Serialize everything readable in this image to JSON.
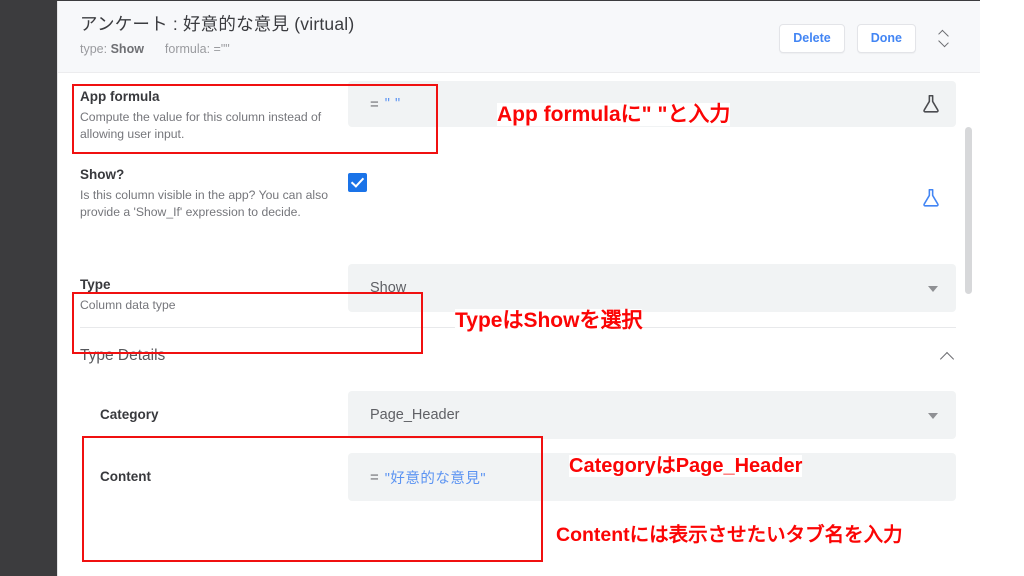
{
  "header": {
    "title": "アンケート : 好意的な意見 (virtual)",
    "meta_type_label": "type:",
    "meta_type_value": "Show",
    "meta_formula_label": "formula:",
    "meta_formula_value": "=\"\"",
    "delete_label": "Delete",
    "done_label": "Done",
    "reorder_icon": "up-down-chevron-icon"
  },
  "rows": {
    "app_formula": {
      "title": "App formula",
      "desc": "Compute the value for this column instead of allowing user input.",
      "equals": "=",
      "value": "\" \"",
      "flask_icon": "flask-icon",
      "flask_color": "#4b4c50"
    },
    "show": {
      "title": "Show?",
      "desc": "Is this column visible in the app? You can also provide a 'Show_If' expression to decide.",
      "checked": true,
      "flask_icon": "flask-icon",
      "flask_color": "#4285f4"
    },
    "type": {
      "title": "Type",
      "desc": "Column data type",
      "value": "Show",
      "dropdown_icon": "chevron-down-icon"
    }
  },
  "type_details": {
    "section_title": "Type Details",
    "collapse_icon": "chevron-up-icon",
    "category": {
      "label": "Category",
      "value": "Page_Header",
      "dropdown_icon": "chevron-down-icon"
    },
    "content": {
      "label": "Content",
      "equals": "=",
      "value": "\"好意的な意見\""
    }
  },
  "annotations": [
    {
      "id": "note-app-formula",
      "text": "App formulaに\" \"と入力"
    },
    {
      "id": "note-type",
      "text": "TypeはShowを選択"
    },
    {
      "id": "note-category",
      "text": "CategoryはPage_Header"
    },
    {
      "id": "note-content",
      "text": "Contentには表示させたいタブ名を入力"
    }
  ],
  "colors": {
    "annotation_red": "#fb0505",
    "link_blue": "#4285f4",
    "checkbox_blue": "#1a73e8",
    "expression_blue": "#5b93f2",
    "field_gray": "#f1f3f4",
    "header_gray": "#f7f8fa"
  },
  "scrollbar": {
    "orientation": "vertical"
  }
}
